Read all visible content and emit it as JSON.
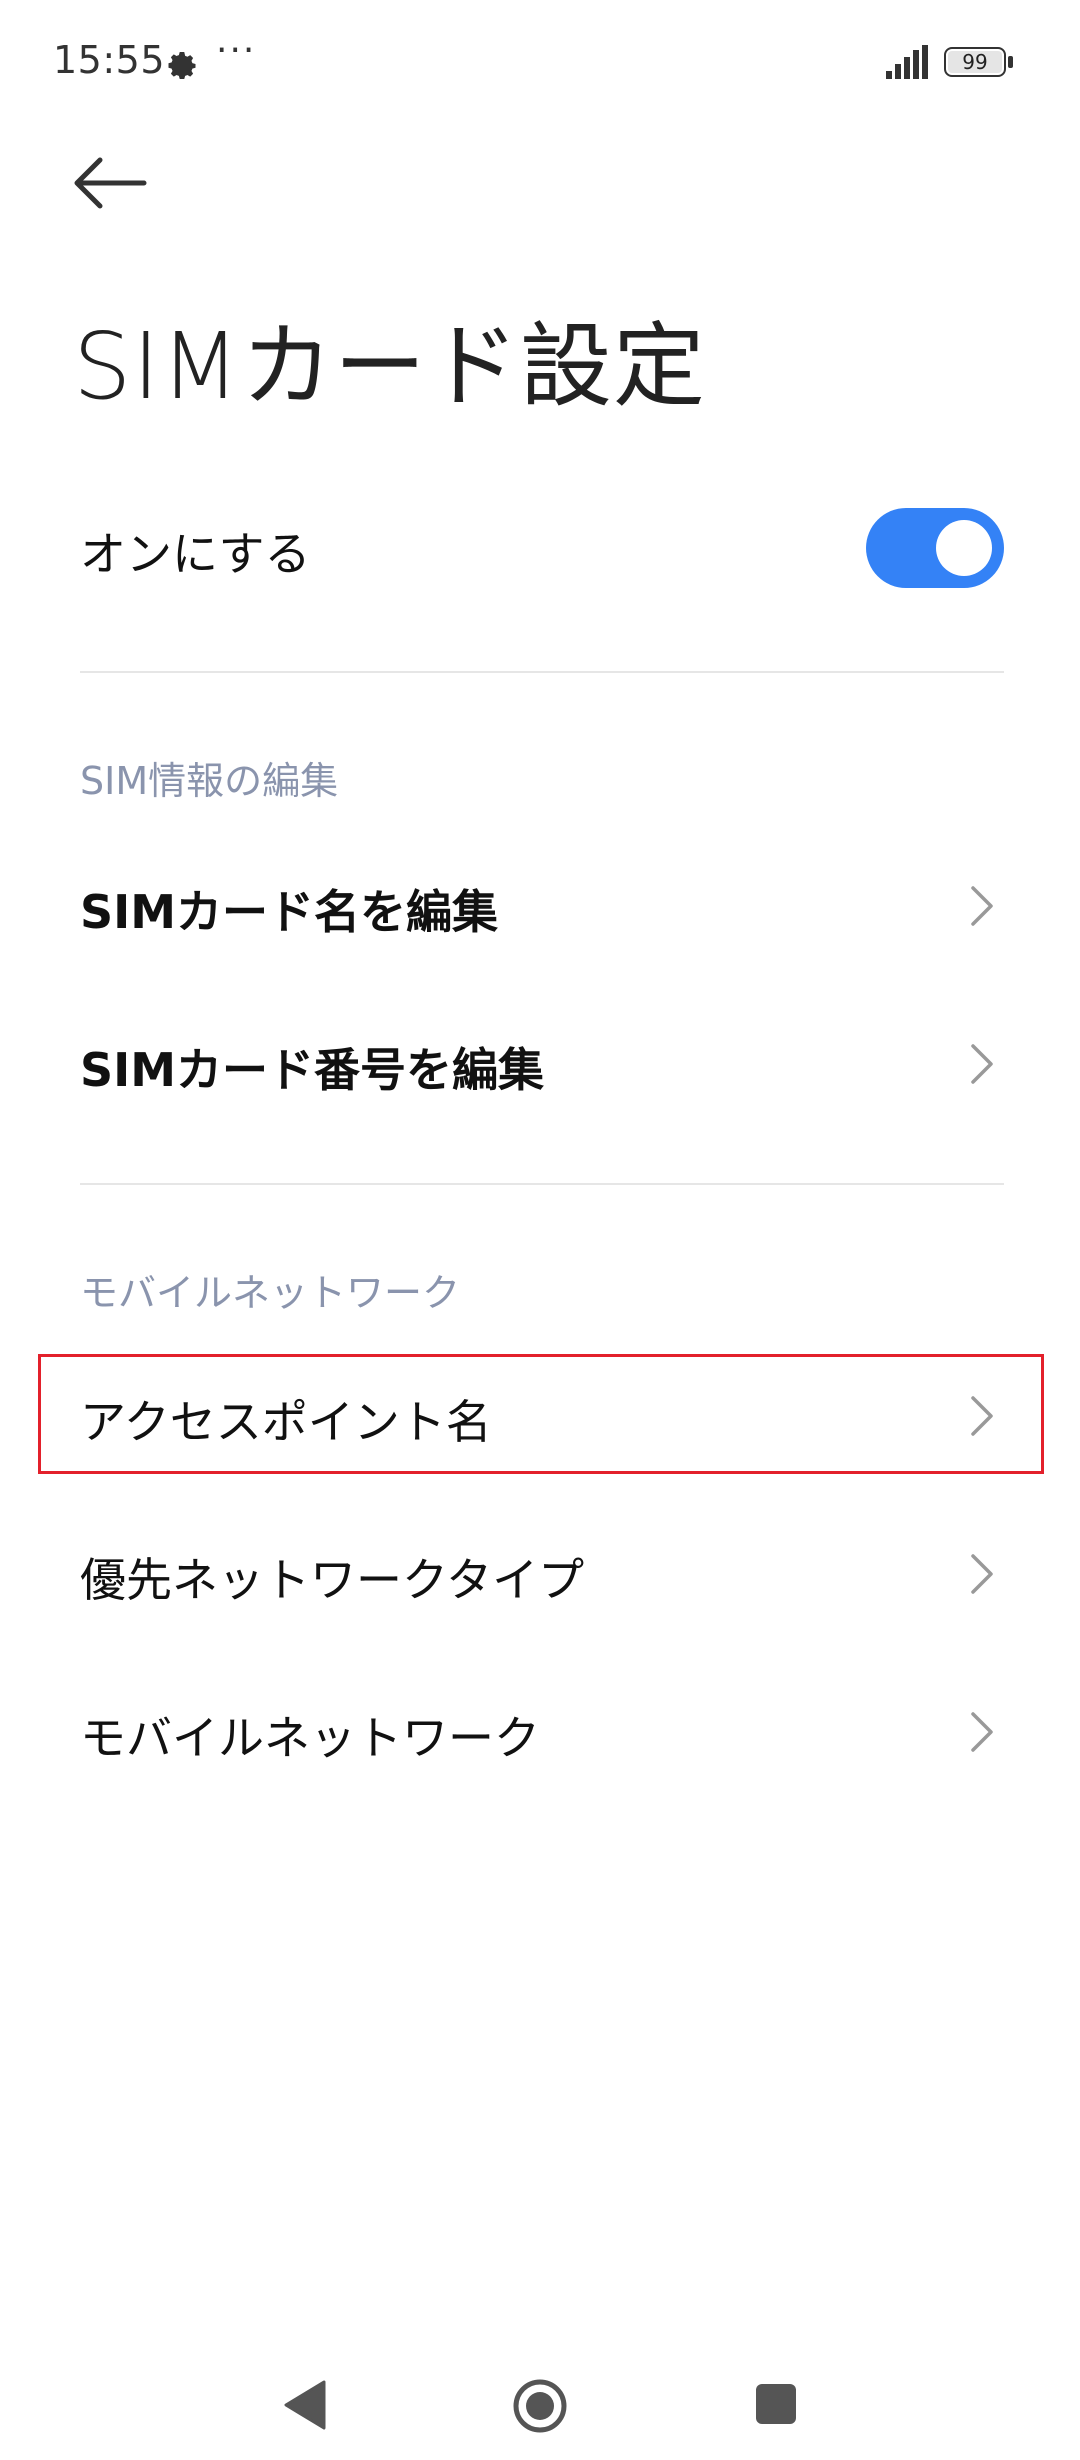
{
  "status_bar": {
    "time": "15:55",
    "battery": "99",
    "overflow": "···"
  },
  "header": {
    "title": "SIMカード設定"
  },
  "toggle": {
    "label": "オンにする",
    "state": "on"
  },
  "sections": [
    {
      "header": "SIM情報の編集",
      "items": [
        {
          "label": "SIMカード名を編集"
        },
        {
          "label": "SIMカード番号を編集"
        }
      ]
    },
    {
      "header": "モバイルネットワーク",
      "items": [
        {
          "label": "アクセスポイント名"
        },
        {
          "label": "優先ネットワークタイプ"
        },
        {
          "label": "モバイルネットワーク"
        }
      ]
    }
  ],
  "colors": {
    "accent": "#3482f6",
    "highlight": "#e3202b",
    "section_header": "#8a94ad"
  }
}
